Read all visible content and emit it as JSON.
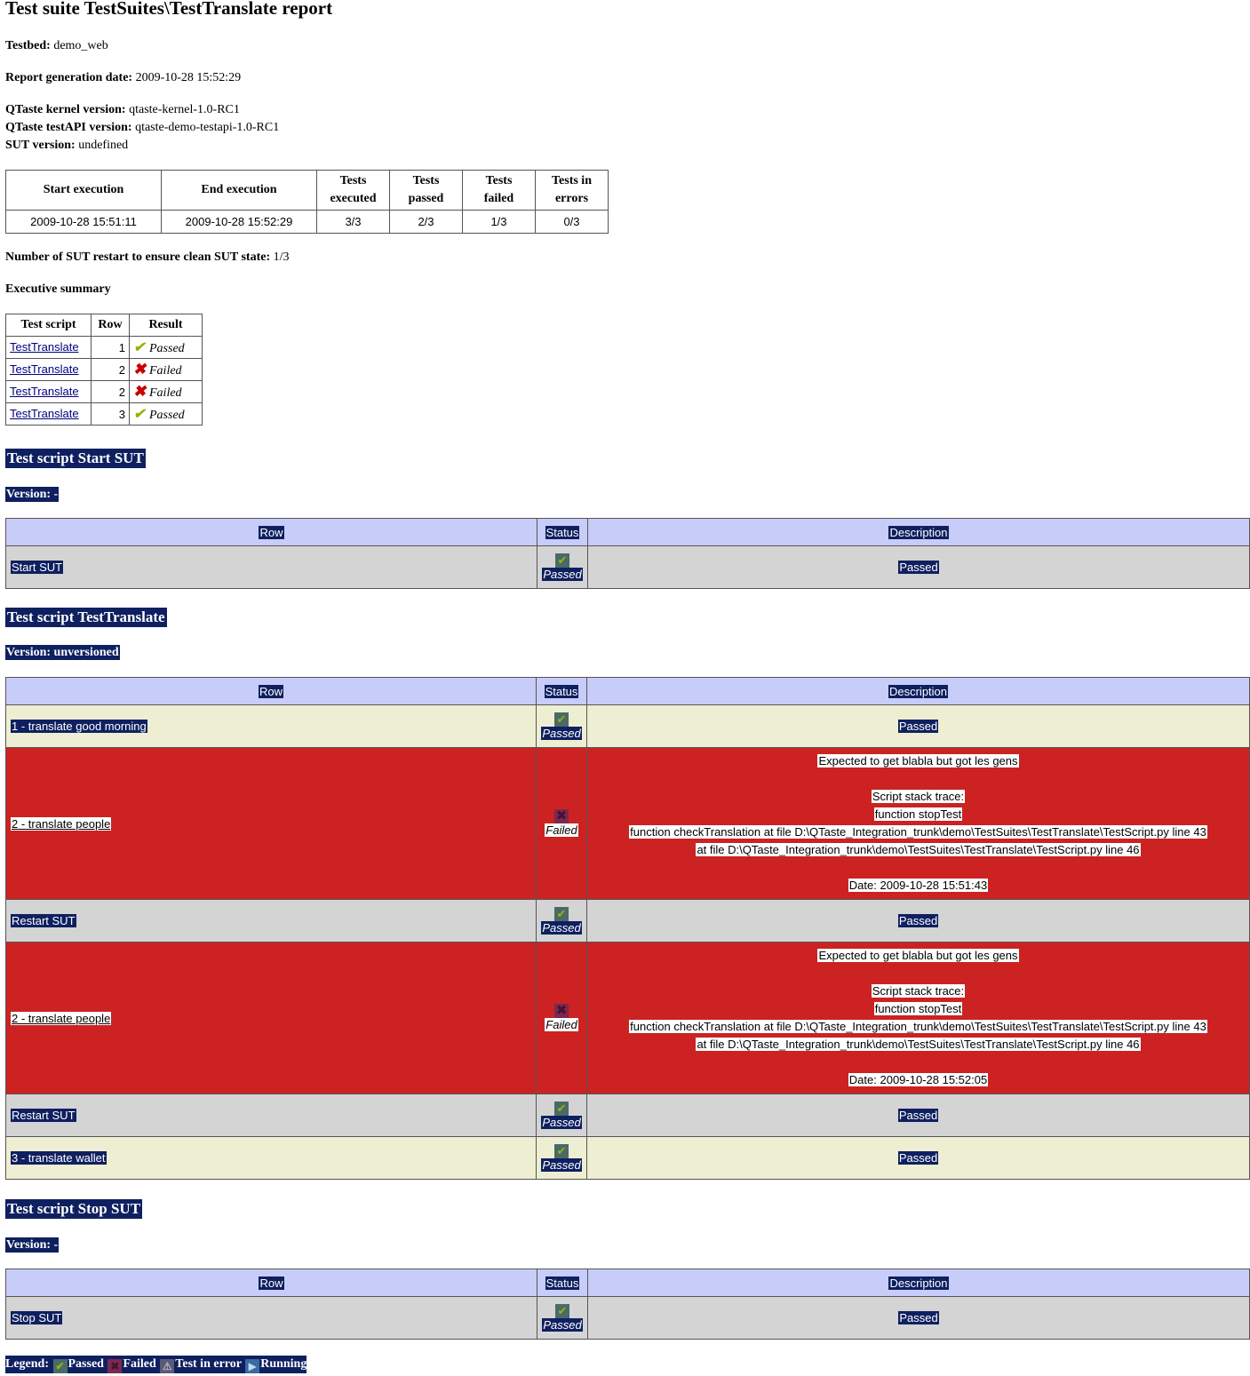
{
  "title": "Test suite TestSuites\\TestTranslate report",
  "meta": {
    "testbed_label": "Testbed:",
    "testbed": "demo_web",
    "report_date_label": "Report generation date:",
    "report_date": "2009-10-28 15:52:29",
    "kernel_label": "QTaste kernel version:",
    "kernel": "qtaste-kernel-1.0-RC1",
    "testapi_label": "QTaste testAPI version:",
    "testapi": "qtaste-demo-testapi-1.0-RC1",
    "sut_label": "SUT version:",
    "sut": "undefined"
  },
  "summary": {
    "headers": [
      "Start execution",
      "End execution",
      "Tests executed",
      "Tests passed",
      "Tests failed",
      "Tests in errors"
    ],
    "values": [
      "2009-10-28 15:51:11",
      "2009-10-28 15:52:29",
      "3/3",
      "2/3",
      "1/3",
      "0/3"
    ]
  },
  "restart_label": "Number of SUT restart to ensure clean SUT state:",
  "restart_value": "1/3",
  "exec_summary_title": "Executive summary",
  "exec": {
    "headers": [
      "Test script",
      "Row",
      "Result"
    ],
    "rows": [
      {
        "script": "TestTranslate",
        "row": "1",
        "result": "Passed",
        "status": "pass"
      },
      {
        "script": "TestTranslate",
        "row": "2",
        "result": "Failed",
        "status": "fail"
      },
      {
        "script": "TestTranslate",
        "row": "2",
        "result": "Failed",
        "status": "fail"
      },
      {
        "script": "TestTranslate",
        "row": "3",
        "result": "Passed",
        "status": "pass"
      }
    ]
  },
  "table_headers": {
    "row": "Row",
    "status": "Status",
    "description": "Description"
  },
  "sections": {
    "start": {
      "title": "Test script Start SUT",
      "version": "Version: -",
      "rows": [
        {
          "label": "Start SUT",
          "status": "Passed",
          "desc": "Passed"
        }
      ]
    },
    "translate": {
      "title": "Test script TestTranslate",
      "version": "Version: unversioned",
      "rows": [
        {
          "label": "1 - translate good morning",
          "status": "Passed",
          "desc": "Passed"
        },
        {
          "label": "2 - translate people",
          "status": "Failed",
          "desc_lines": [
            "Expected to get blabla but got les gens",
            "",
            "Script stack trace:",
            "function stopTest",
            "function checkTranslation at file D:\\QTaste_Integration_trunk\\demo\\TestSuites\\TestTranslate\\TestScript.py line 43",
            "at file D:\\QTaste_Integration_trunk\\demo\\TestSuites\\TestTranslate\\TestScript.py line 46",
            "",
            "Date: 2009-10-28 15:51:43"
          ]
        },
        {
          "label": "Restart SUT",
          "status": "Passed",
          "desc": "Passed"
        },
        {
          "label": "2 - translate people",
          "status": "Failed",
          "desc_lines": [
            "Expected to get blabla but got les gens",
            "",
            "Script stack trace:",
            "function stopTest",
            "function checkTranslation at file D:\\QTaste_Integration_trunk\\demo\\TestSuites\\TestTranslate\\TestScript.py line 43",
            "at file D:\\QTaste_Integration_trunk\\demo\\TestSuites\\TestTranslate\\TestScript.py line 46",
            "",
            "Date: 2009-10-28 15:52:05"
          ]
        },
        {
          "label": "Restart SUT",
          "status": "Passed",
          "desc": "Passed"
        },
        {
          "label": "3 - translate wallet",
          "status": "Passed",
          "desc": "Passed"
        }
      ]
    },
    "stop": {
      "title": "Test script Stop SUT",
      "version": "Version: -",
      "rows": [
        {
          "label": "Stop SUT",
          "status": "Passed",
          "desc": "Passed"
        }
      ]
    }
  },
  "legend": {
    "label": "Legend:",
    "passed": "Passed",
    "failed": "Failed",
    "error": "Test in error",
    "running": "Running"
  },
  "icons": {
    "passed": "check-icon",
    "failed": "cross-icon",
    "error": "warning-icon",
    "running": "running-icon"
  },
  "colors": {
    "header_bg": "#c8ccf8",
    "passed_row_bg": "#d4d4d4",
    "passed_row_bg_alt": "#eeeed2",
    "failed_row_bg": "#cc2222",
    "selection_bg": "#0f2060",
    "check": "#94b400",
    "cross": "#c80000"
  }
}
